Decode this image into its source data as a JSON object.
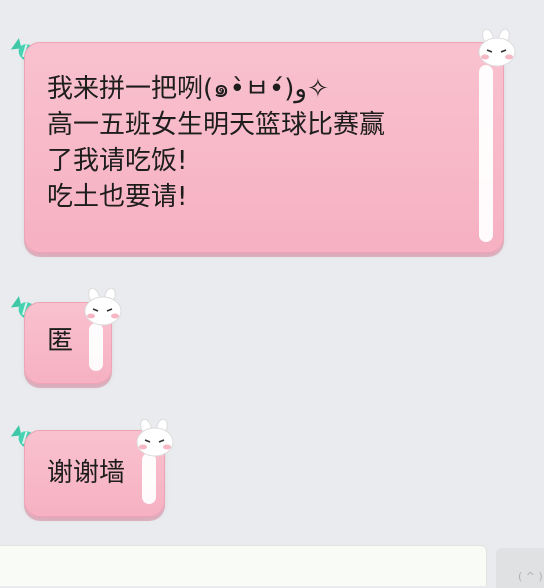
{
  "chat": {
    "messages": [
      {
        "lines": [
          "我来拼一把咧(๑•̀ㅂ•́)و✧",
          "高一五班女生明天篮球比赛赢",
          "了我请吃饭!",
          "吃土也要请!"
        ]
      },
      {
        "lines": [
          "匿"
        ]
      },
      {
        "lines": [
          "谢谢墙"
        ]
      }
    ]
  },
  "input": {
    "emoji_glyph": "( ^ )"
  },
  "colors": {
    "bubble": "#f7b6c6",
    "candy": "#3ec8a8",
    "background": "#e9ebee"
  },
  "icons": [
    "candy-icon",
    "bunny-icon",
    "emoji-icon"
  ]
}
